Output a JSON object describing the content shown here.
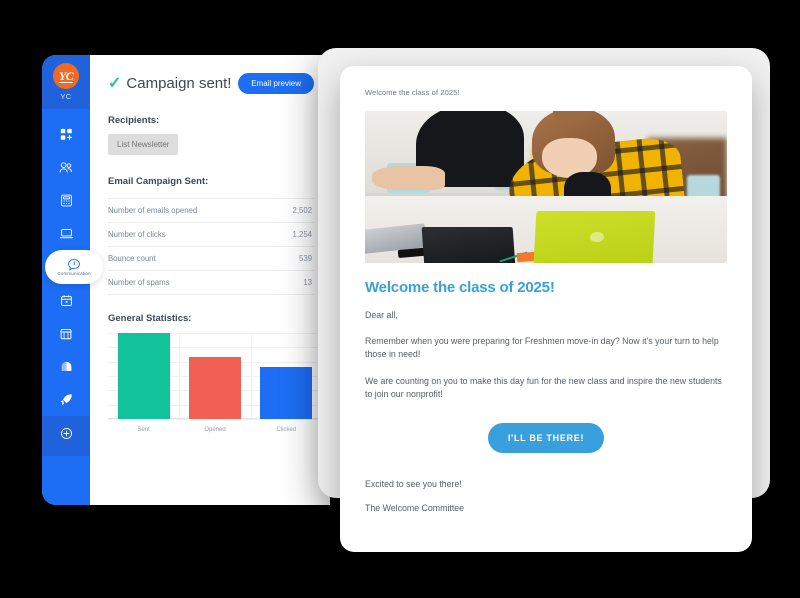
{
  "app": {
    "sidebar": {
      "brand": {
        "logo_text": "YC",
        "name": "YC"
      },
      "items": [
        {
          "label": "Dashboard",
          "icon": "grid-plus-icon",
          "active": false
        },
        {
          "label": "Contacts",
          "icon": "people-icon",
          "active": false
        },
        {
          "label": "Accounting",
          "icon": "calculator-icon",
          "active": false
        },
        {
          "label": "Website",
          "icon": "laptop-icon",
          "active": false
        },
        {
          "label": "Communication",
          "icon": "chat-bubble-icon",
          "active": true
        },
        {
          "label": "Events",
          "icon": "calendar-icon",
          "active": false
        },
        {
          "label": "Store",
          "icon": "shop-icon",
          "active": false
        },
        {
          "label": "Support",
          "icon": "helmet-icon",
          "active": false
        },
        {
          "label": "Campaigns",
          "icon": "rocket-icon",
          "active": false
        }
      ],
      "add_button": {
        "label": "Add",
        "icon": "plus-circle-icon"
      }
    },
    "main": {
      "status_title": "Campaign sent!",
      "status_check_icon": "check-icon",
      "preview_button": "Email preview",
      "recipients_label": "Recipients:",
      "recipient_chip": "List Newsletter",
      "campaign_label": "Email Campaign Sent:",
      "stats": [
        {
          "label": "Number of emails opened",
          "value": "2,502"
        },
        {
          "label": "Number of clicks",
          "value": "1,254"
        },
        {
          "label": "Bounce count",
          "value": "539"
        },
        {
          "label": "Number of spams",
          "value": "13"
        }
      ],
      "general_label": "General Statistics:"
    }
  },
  "chart_data": {
    "type": "bar",
    "title": "General Statistics:",
    "categories": [
      "Sent",
      "Opened",
      "Clicked"
    ],
    "values": [
      100,
      72,
      60
    ],
    "colors": [
      "#11c29a",
      "#f15f55",
      "#1d6ef5"
    ],
    "xlabel": "",
    "ylabel": "",
    "ylim": [
      0,
      100
    ],
    "grid": true,
    "legend": "none"
  },
  "email": {
    "subject": "Welcome the class of 2025!",
    "hero_image_alt": "students-at-desk-with-laptops-photo",
    "heading": "Welcome the class of 2025!",
    "greeting": "Dear all,",
    "paragraph1": "Remember when you were preparing for Freshmen move-in day? Now it's your turn to help those in need!",
    "paragraph2": "We are counting on you to make this day fun for the new class and inspire the new students to join our nonprofit!",
    "cta": "I'LL BE THERE!",
    "closing": "Excited to see you there!",
    "signature": "The Welcome Committee"
  },
  "colors": {
    "sidebar_blue": "#1d6ef5",
    "brand_orange": "#ef6a23",
    "success_green": "#16cc99",
    "email_accent": "#3aa0dd",
    "bar_sent": "#11c29a",
    "bar_opened": "#f15f55",
    "bar_clicked": "#1d6ef5"
  }
}
